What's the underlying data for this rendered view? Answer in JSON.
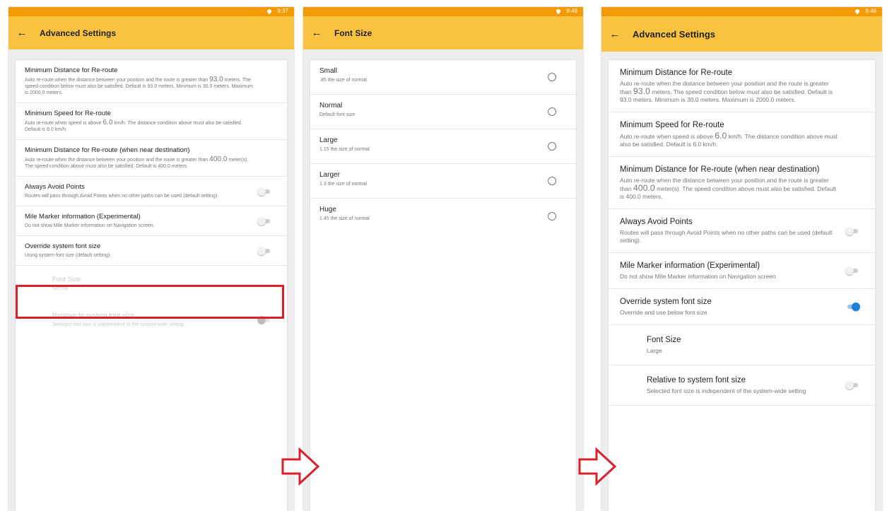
{
  "status": {
    "time1": "9:37",
    "time2": "9:48",
    "time3": "9:46"
  },
  "screen1": {
    "title": "Advanced Settings",
    "items": [
      {
        "title": "Minimum Distance for Re-route",
        "desc_a": "Auto re-route when the distance between your position and the route is greater than ",
        "value": "93.0",
        "desc_b": " meters. The speed condition below must also be satisfied. Default is 93.0 meters. Minimum is 30.0 meters. Maximum is 2000.0 meters."
      },
      {
        "title": "Minimum Speed for Re-route",
        "desc_a": "Auto re-route when speed is above ",
        "value": "6.0",
        "desc_b": " km/h. The distance condition above must also be satisfied. Default is 6.0 km/h."
      },
      {
        "title": "Minimum Distance for Re-route (when near destination)",
        "desc_a": "Auto re-route when the distance between your position and the route is greater than ",
        "value": "400.0",
        "desc_b": " meter(s). The speed condition above must also be satisfied. Default is 400.0 meters."
      },
      {
        "title": "Always Avoid Points",
        "desc": "Routes will pass through Avoid Points when no other paths can be used (default setting)."
      },
      {
        "title": "Mile Marker information (Experimental)",
        "desc": "Do not show Mile Marker information on Navigation screen."
      },
      {
        "title": "Override system font size",
        "desc": "Using system font size (default setting)."
      },
      {
        "title": "Font Size",
        "desc": "Normal"
      },
      {
        "title": "Relative to system font size",
        "desc": "Selected font size is independent of the system-wide setting"
      }
    ]
  },
  "screen2": {
    "title": "Font Size",
    "options": [
      {
        "label": "Small",
        "desc": ".85 the size of normal"
      },
      {
        "label": "Normal",
        "desc": "Default font size"
      },
      {
        "label": "Large",
        "desc": "1.15 the size of normal"
      },
      {
        "label": "Larger",
        "desc": "1.3 the size of normal"
      },
      {
        "label": "Huge",
        "desc": "1.45 the size of normal"
      }
    ]
  },
  "screen3": {
    "title": "Advanced Settings",
    "items": [
      {
        "title": "Minimum Distance for Re-route",
        "desc_a": "Auto re-route when the distance between your position and the route is greater than ",
        "value": "93.0",
        "desc_b": " meters. The speed condition below must also be satisfied. Default is 93.0 meters. Minimum is 30.0 meters. Maximum is 2000.0 meters."
      },
      {
        "title": "Minimum Speed for Re-route",
        "desc_a": "Auto re-route when speed is above ",
        "value": "6.0",
        "desc_b": " km/h. The distance condition above must also be satisfied. Default is 6.0 km/h."
      },
      {
        "title": "Minimum Distance for Re-route (when near destination)",
        "desc_a": "Auto re-route when the distance between your position and the route is greater than ",
        "value": "400.0",
        "desc_b": " meter(s). The speed condition above must also be satisfied. Default is 400.0 meters."
      },
      {
        "title": "Always Avoid Points",
        "desc": "Routes will pass through Avoid Points when no other paths can be used (default setting)."
      },
      {
        "title": "Mile Marker information (Experimental)",
        "desc": "Do not show Mile Marker information on Navigation screen."
      },
      {
        "title": "Override system font size",
        "desc": "Override and use below font size."
      },
      {
        "title": "Font Size",
        "desc": "Large"
      },
      {
        "title": "Relative to system font size",
        "desc": "Selected font size is independent of the system-wide setting"
      }
    ]
  },
  "colors": {
    "status_bar": "#f39a00",
    "app_bar": "#f9c240",
    "highlight": "#d9212b",
    "toggle_on": "#1a82d6"
  },
  "icons": {
    "back": "arrow-left-icon",
    "location": "location-pin-icon",
    "flow": "right-arrow-icon"
  }
}
